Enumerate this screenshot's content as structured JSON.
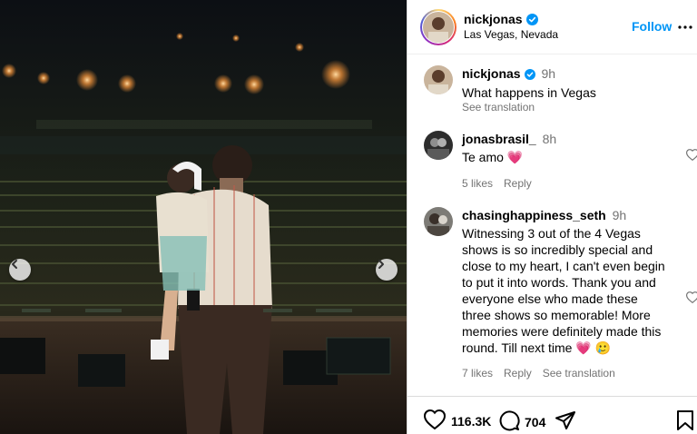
{
  "post": {
    "author": "nickjonas",
    "location": "Las Vegas, Nevada",
    "follow_label": "Follow",
    "caption": {
      "username": "nickjonas",
      "time": "9h",
      "text": "What happens in Vegas",
      "see_translation": "See translation"
    }
  },
  "comments": [
    {
      "username": "jonasbrasil_",
      "time": "8h",
      "text": "Te amo 💗",
      "likes": "5 likes",
      "reply": "Reply",
      "see_translation": ""
    },
    {
      "username": "chasinghappiness_seth",
      "time": "9h",
      "text": "Witnessing 3 out of the 4 Vegas shows is so incredibly special and close to my heart, I can't even begin to put it into words. Thank you and everyone else who made these three shows so memorable! More memories were definitely made this round. Till next time 💗 🥲",
      "likes": "7 likes",
      "reply": "Reply",
      "see_translation": "See translation"
    }
  ],
  "actions": {
    "likes_count": "116.3K",
    "comments_count": "704"
  },
  "colors": {
    "accent": "#0095f6",
    "verified": "#0095f6",
    "muted": "#737373"
  },
  "icons": {
    "verified": "verified-badge-icon",
    "more": "more-options-icon",
    "like": "heart-icon",
    "comment": "comment-icon",
    "share": "share-icon",
    "save": "bookmark-icon",
    "prev": "chevron-left-icon",
    "next": "chevron-right-icon"
  }
}
